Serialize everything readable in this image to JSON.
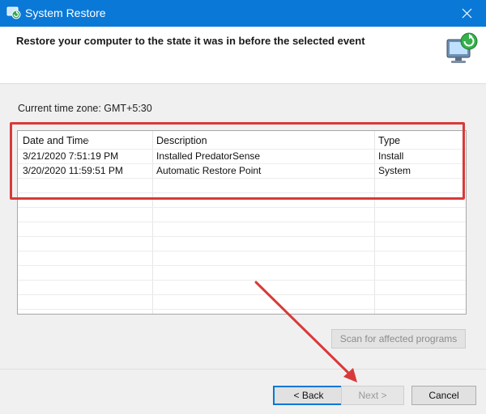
{
  "window": {
    "title": "System Restore"
  },
  "header": {
    "text": "Restore your computer to the state it was in before the selected event"
  },
  "timezone": {
    "label": "Current time zone: GMT+5:30"
  },
  "table": {
    "columns": [
      "Date and Time",
      "Description",
      "Type"
    ],
    "rows": [
      [
        "3/21/2020 7:51:19 PM",
        "Installed PredatorSense",
        "Install"
      ],
      [
        "3/20/2020 11:59:51 PM",
        "Automatic Restore Point",
        "System"
      ]
    ]
  },
  "buttons": {
    "scan": "Scan for affected programs",
    "back": "< Back",
    "next": "Next >",
    "cancel": "Cancel"
  },
  "annotation": {
    "color": "#d83a3a"
  },
  "colors": {
    "titlebar": "#0a78d7",
    "accent": "#0078d7"
  }
}
